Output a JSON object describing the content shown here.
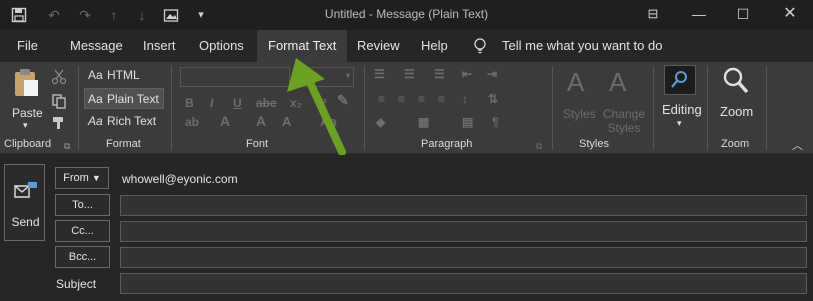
{
  "titlebar": {
    "title": "Untitled  -  Message (Plain Text)"
  },
  "tabs": [
    {
      "label": "File"
    },
    {
      "label": "Message"
    },
    {
      "label": "Insert"
    },
    {
      "label": "Options"
    },
    {
      "label": "Format Text"
    },
    {
      "label": "Review"
    },
    {
      "label": "Help"
    }
  ],
  "active_tab": "Format Text",
  "tellme": {
    "label": "Tell me what you want to do"
  },
  "ribbon": {
    "clipboard": {
      "paste_label": "Paste",
      "group_label": "Clipboard"
    },
    "format": {
      "html_label": "HTML",
      "plain_label": "Plain Text",
      "rich_label": "Rich Text",
      "icon_prefix": "Aa",
      "group_label": "Format",
      "selected": "Plain Text"
    },
    "font": {
      "group_label": "Font"
    },
    "paragraph": {
      "group_label": "Paragraph"
    },
    "styles": {
      "styles_label": "Styles",
      "change_styles_label": "Change Styles",
      "group_label": "Styles"
    },
    "editing": {
      "label": "Editing"
    },
    "zoom": {
      "label": "Zoom",
      "group_label": "Zoom"
    }
  },
  "compose": {
    "send_label": "Send",
    "from_button": "From",
    "from_value": "whowell@eyonic.com",
    "to_button": "To...",
    "cc_button": "Cc...",
    "bcc_button": "Bcc...",
    "subject_label": "Subject"
  },
  "colors": {
    "background": "#262626",
    "ribbon": "#3b3b3b",
    "arrow": "#6aa121",
    "accent": "#5b9bd5"
  }
}
